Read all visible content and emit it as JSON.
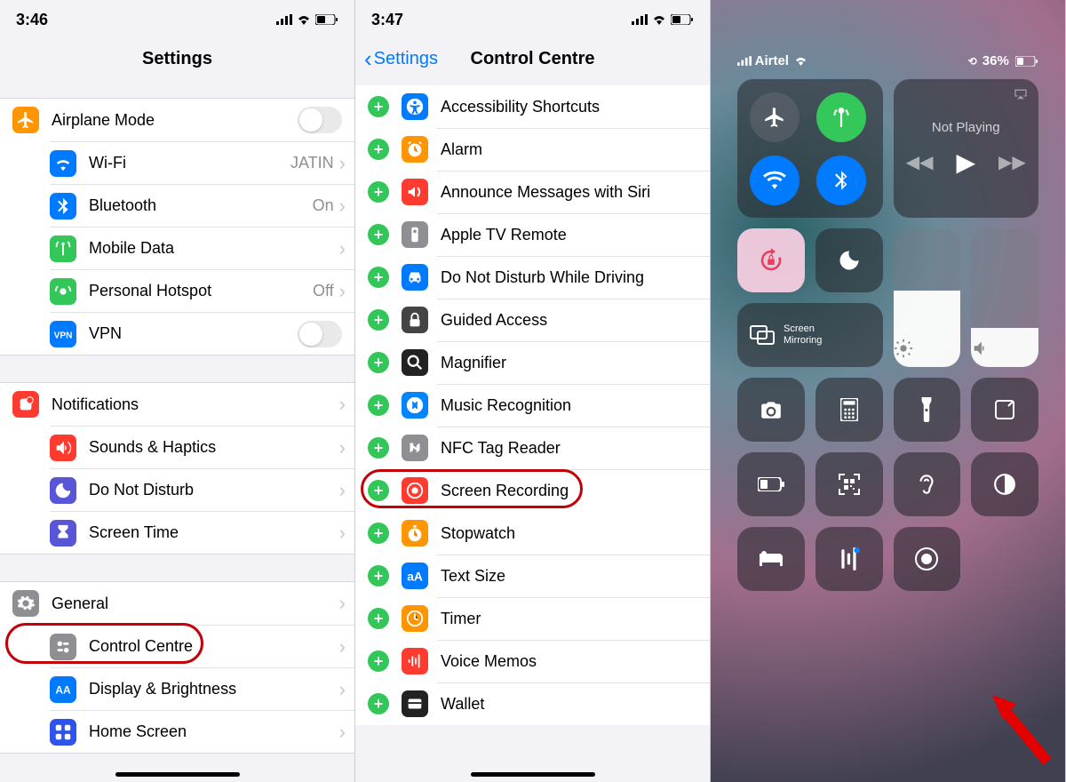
{
  "panel1": {
    "time": "3:46",
    "title": "Settings",
    "sections": [
      [
        {
          "icon": "airplane",
          "color": "#ff9501",
          "label": "Airplane Mode",
          "accessory": "toggle"
        },
        {
          "icon": "wifi",
          "color": "#007AFF",
          "label": "Wi-Fi",
          "value": "JATIN",
          "accessory": "disclosure"
        },
        {
          "icon": "bluetooth",
          "color": "#007AFF",
          "label": "Bluetooth",
          "value": "On",
          "accessory": "disclosure"
        },
        {
          "icon": "antenna",
          "color": "#33c759",
          "label": "Mobile Data",
          "accessory": "disclosure"
        },
        {
          "icon": "hotspot",
          "color": "#33c759",
          "label": "Personal Hotspot",
          "value": "Off",
          "accessory": "disclosure"
        },
        {
          "icon": "vpn",
          "color": "#007AFF",
          "label": "VPN",
          "accessory": "toggle"
        }
      ],
      [
        {
          "icon": "notifications",
          "color": "#ff3b30",
          "label": "Notifications",
          "accessory": "disclosure"
        },
        {
          "icon": "sounds",
          "color": "#ff3b30",
          "label": "Sounds & Haptics",
          "accessory": "disclosure"
        },
        {
          "icon": "moon",
          "color": "#5856d6",
          "label": "Do Not Disturb",
          "accessory": "disclosure"
        },
        {
          "icon": "hourglass",
          "color": "#5856d6",
          "label": "Screen Time",
          "accessory": "disclosure"
        }
      ],
      [
        {
          "icon": "gear",
          "color": "#8e8e93",
          "label": "General",
          "accessory": "disclosure"
        },
        {
          "icon": "switches",
          "color": "#8e8e93",
          "label": "Control Centre",
          "accessory": "disclosure",
          "circled": true
        },
        {
          "icon": "aa",
          "color": "#007AFF",
          "label": "Display & Brightness",
          "accessory": "disclosure"
        },
        {
          "icon": "grid",
          "color": "#2f54eb",
          "label": "Home Screen",
          "accessory": "disclosure"
        }
      ]
    ]
  },
  "panel2": {
    "time": "3:47",
    "back": "Settings",
    "title": "Control Centre",
    "items": [
      {
        "icon": "accessibility",
        "color": "#007AFF",
        "label": "Accessibility Shortcuts"
      },
      {
        "icon": "alarm",
        "color": "#ff9500",
        "label": "Alarm"
      },
      {
        "icon": "announce",
        "color": "#ff3b30",
        "label": "Announce Messages with Siri"
      },
      {
        "icon": "remote",
        "color": "#8e8e93",
        "label": "Apple TV Remote"
      },
      {
        "icon": "car",
        "color": "#007AFF",
        "label": "Do Not Disturb While Driving"
      },
      {
        "icon": "lock",
        "color": "#444",
        "label": "Guided Access"
      },
      {
        "icon": "magnifier",
        "color": "#222",
        "label": "Magnifier"
      },
      {
        "icon": "shazam",
        "color": "#0084ff",
        "label": "Music Recognition"
      },
      {
        "icon": "nfc",
        "color": "#8e8e93",
        "label": "NFC Tag Reader"
      },
      {
        "icon": "record",
        "color": "#ff3b30",
        "label": "Screen Recording",
        "circled": true
      },
      {
        "icon": "stopwatch",
        "color": "#ff9500",
        "label": "Stopwatch"
      },
      {
        "icon": "textsize",
        "color": "#007AFF",
        "label": "Text Size"
      },
      {
        "icon": "timer",
        "color": "#ff9500",
        "label": "Timer"
      },
      {
        "icon": "voicememo",
        "color": "#ff3b30",
        "label": "Voice Memos"
      },
      {
        "icon": "wallet",
        "color": "#222",
        "label": "Wallet"
      }
    ]
  },
  "panel3": {
    "carrier": "Airtel",
    "battery": "36%",
    "media_label": "Not Playing",
    "mirror_label": "Screen Mirroring",
    "brightness_pct": 55,
    "volume_pct": 28,
    "connectivity": [
      {
        "name": "airplane",
        "active": false,
        "color": "dark"
      },
      {
        "name": "cellular",
        "active": true,
        "color": "green"
      },
      {
        "name": "wifi",
        "active": true,
        "color": "blue"
      },
      {
        "name": "bluetooth",
        "active": true,
        "color": "blue"
      }
    ],
    "tiles": [
      {
        "name": "orientation-lock",
        "icon": "lock-rotate",
        "style": "lock"
      },
      {
        "name": "do-not-disturb",
        "icon": "moon"
      },
      {
        "name": "screen-mirroring",
        "icon": "mirror",
        "span": "2x1",
        "label": "Screen Mirroring"
      },
      {
        "name": "camera",
        "icon": "camera"
      },
      {
        "name": "calculator",
        "icon": "calculator"
      },
      {
        "name": "flashlight",
        "icon": "flashlight"
      },
      {
        "name": "notes",
        "icon": "notes"
      },
      {
        "name": "low-power",
        "icon": "battery"
      },
      {
        "name": "qr-scanner",
        "icon": "qr"
      },
      {
        "name": "hearing",
        "icon": "ear"
      },
      {
        "name": "dark-mode",
        "icon": "darkmode"
      },
      {
        "name": "sleep",
        "icon": "bed"
      },
      {
        "name": "shazam",
        "icon": "shazam-cc"
      },
      {
        "name": "screen-recording",
        "icon": "record-cc"
      }
    ]
  }
}
